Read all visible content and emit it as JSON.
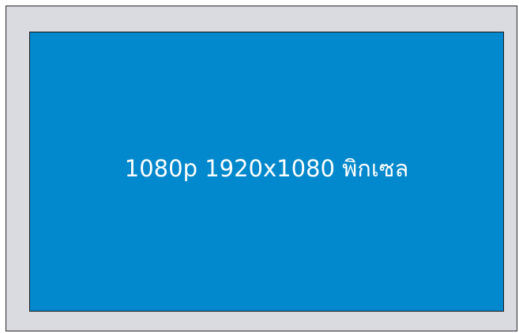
{
  "display": {
    "label": "1080p 1920x1080 พิกเซล",
    "bezel_color": "#d9dbe0",
    "screen_color": "#0288cc"
  }
}
